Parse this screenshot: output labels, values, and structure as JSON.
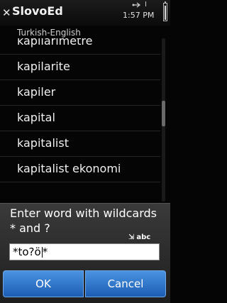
{
  "statusbar": {
    "app_title": "SlovoEd",
    "clock": "1:57 PM",
    "usb_icon": "usb-icon",
    "bluetooth_icon": "bluetooth-icon",
    "battery_level": 0.85
  },
  "subtitle": "Turkish-English",
  "list": {
    "items": [
      {
        "label": "kapilarimetre"
      },
      {
        "label": "kapilarite"
      },
      {
        "label": "kapiler"
      },
      {
        "label": "kapital"
      },
      {
        "label": "kapitalist"
      },
      {
        "label": "kapitalist ekonomi"
      }
    ]
  },
  "dialog": {
    "title": "Enter word with wildcards * and ?",
    "mode_indicator": "abc",
    "input_value": "*to?ö",
    "input_value_after_caret": "*",
    "ok_label": "OK",
    "cancel_label": "Cancel",
    "accent_color": "#2c6fcc"
  }
}
